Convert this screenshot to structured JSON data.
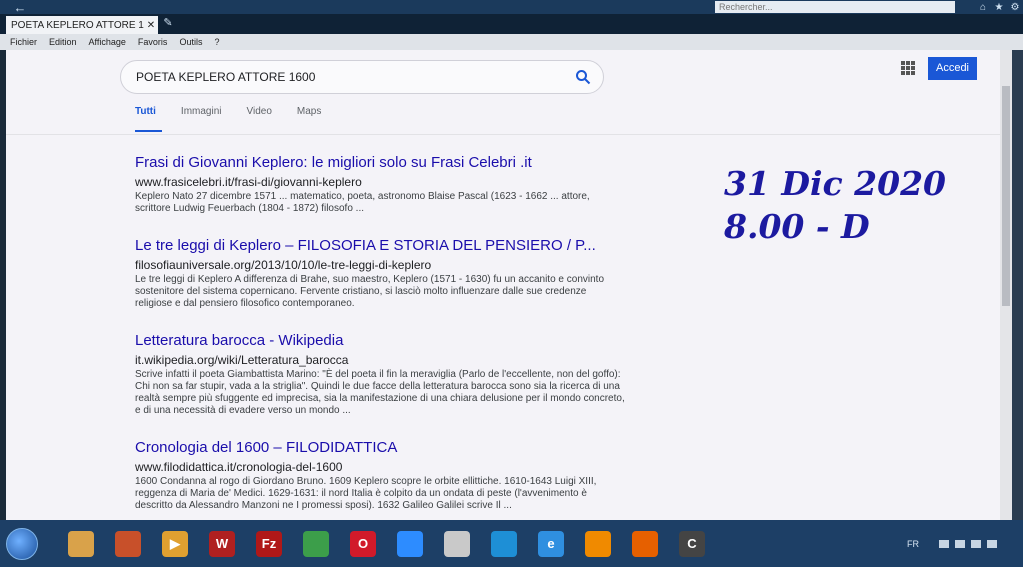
{
  "browser": {
    "tab_title": "POETA KEPLERO ATTORE 1...",
    "search_placeholder": "Rechercher...",
    "menu": [
      "Fichier",
      "Edition",
      "Affichage",
      "Favoris",
      "Outils",
      "?"
    ]
  },
  "search": {
    "query": "POETA KEPLERO ATTORE 1600",
    "tabs": [
      "Tutti",
      "Immagini",
      "Video",
      "Maps"
    ],
    "signin_label": "Accedi"
  },
  "results": [
    {
      "title": "Frasi di Giovanni Keplero: le migliori solo su Frasi Celebri .it",
      "url": "www.frasicelebri.it/frasi-di/giovanni-keplero",
      "snippet": "Keplero Nato 27 dicembre 1571 ... matematico, poeta, astronomo Blaise Pascal (1623 - 1662 ... attore, scrittore Ludwig Feuerbach (1804 - 1872) filosofo ..."
    },
    {
      "title": "Le tre leggi di Keplero – FILOSOFIA E STORIA DEL PENSIERO / P...",
      "url": "filosofiauniversale.org/2013/10/10/le-tre-leggi-di-keplero",
      "snippet": "Le tre leggi di Keplero A differenza di Brahe, suo maestro, Keplero (1571 - 1630) fu un accanito e convinto sostenitore del sistema copernicano. Fervente cristiano, si lasciò molto influenzare dalle sue credenze religiose e dal pensiero filosofico contemporaneo."
    },
    {
      "title": "Letteratura barocca - Wikipedia",
      "url": "it.wikipedia.org/wiki/Letteratura_barocca",
      "snippet": "Scrive infatti il poeta Giambattista Marino: \"È del poeta il fin la meraviglia (Parlo de l'eccellente, non del goffo): Chi non sa far stupir, vada a la striglia\". Quindi le due facce della letteratura barocca sono sia la ricerca di una realtà sempre più sfuggente ed imprecisa, sia la manifestazione di una chiara delusione per il mondo concreto, e di una necessità di evadere verso un mondo ..."
    },
    {
      "title": "Cronologia del 1600 – FILODIDATTICA",
      "url": "www.filodidattica.it/cronologia-del-1600",
      "snippet": "1600 Condanna al rogo di Giordano Bruno. 1609 Keplero scopre le orbite ellittiche. 1610-1643 Luigi XIII, reggenza di Maria de' Medici. 1629-1631: il nord Italia è colpito da un ondata di peste (l'avvenimento è descritto da Alessandro Manzoni ne I promessi sposi). 1632 Galileo Galilei scrive Il ..."
    }
  ],
  "annotation": {
    "line1": "31 Dic 2020",
    "line2": "8.00 - D"
  },
  "taskbar": {
    "language": "FR",
    "apps": [
      {
        "name": "folder-app-icon",
        "color": "#d9a24a",
        "glyph": ""
      },
      {
        "name": "office-app-icon",
        "color": "#c8502a",
        "glyph": ""
      },
      {
        "name": "media-player-app-icon",
        "color": "#e0a030",
        "glyph": "▶"
      },
      {
        "name": "wikipedia-app-icon",
        "color": "#b02020",
        "glyph": "W"
      },
      {
        "name": "filezilla-app-icon",
        "color": "#b01818",
        "glyph": "Fz"
      },
      {
        "name": "chrome-app-icon",
        "color": "#3c9e4a",
        "glyph": ""
      },
      {
        "name": "opera-app-icon",
        "color": "#d11a2a",
        "glyph": "O"
      },
      {
        "name": "zoom-app-icon",
        "color": "#2d8cff",
        "glyph": ""
      },
      {
        "name": "files-app-icon",
        "color": "#c9c9c9",
        "glyph": ""
      },
      {
        "name": "edge-app-icon",
        "color": "#1e8fd6",
        "glyph": ""
      },
      {
        "name": "internet-explorer-app-icon",
        "color": "#2f8fe0",
        "glyph": "e"
      },
      {
        "name": "vlc-app-icon",
        "color": "#f08a00",
        "glyph": ""
      },
      {
        "name": "firefox-app-icon",
        "color": "#e66000",
        "glyph": ""
      },
      {
        "name": "ccleaner-app-icon",
        "color": "#444444",
        "glyph": "C"
      }
    ]
  }
}
